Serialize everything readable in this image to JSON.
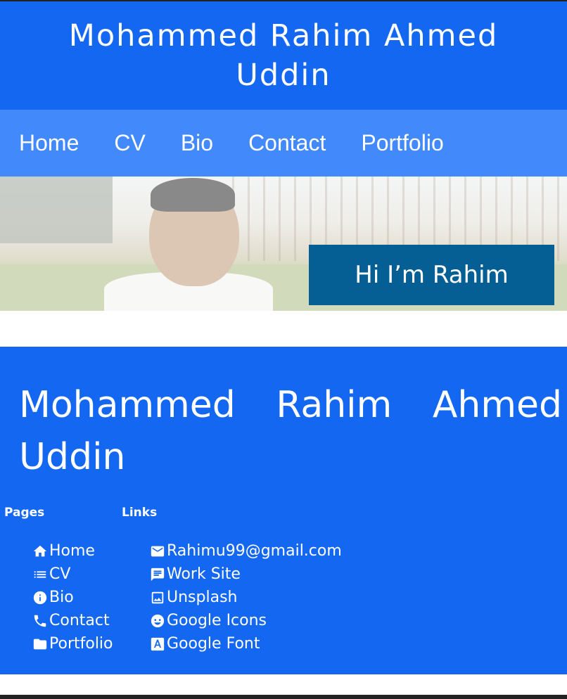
{
  "header": {
    "title": "Mohammed Rahim Ahmed Uddin"
  },
  "nav": {
    "items": [
      "Home",
      "CV",
      "Bio",
      "Contact",
      "Portfolio"
    ]
  },
  "hero": {
    "greeting": "Hi I’m Rahim"
  },
  "footer": {
    "name": "Mohammed Rahim Ahmed Uddin",
    "pages_heading": "Pages",
    "links_heading": "Links",
    "pages": [
      {
        "label": "Home",
        "icon": "home-icon"
      },
      {
        "label": "CV",
        "icon": "list-icon"
      },
      {
        "label": "Bio",
        "icon": "info-icon"
      },
      {
        "label": "Contact",
        "icon": "phone-icon"
      },
      {
        "label": "Portfolio",
        "icon": "folder-icon"
      }
    ],
    "links": [
      {
        "label": "Rahimu99@gmail.com",
        "icon": "mail-icon"
      },
      {
        "label": "Work Site",
        "icon": "chat-icon"
      },
      {
        "label": "Unsplash",
        "icon": "image-icon"
      },
      {
        "label": "Google Icons",
        "icon": "face-icon"
      },
      {
        "label": "Google Font",
        "icon": "font-icon"
      }
    ]
  },
  "colors": {
    "header_bg": "#1467f0",
    "nav_bg": "#4289fb",
    "badge_bg": "#065f94",
    "text": "#ffffff"
  }
}
